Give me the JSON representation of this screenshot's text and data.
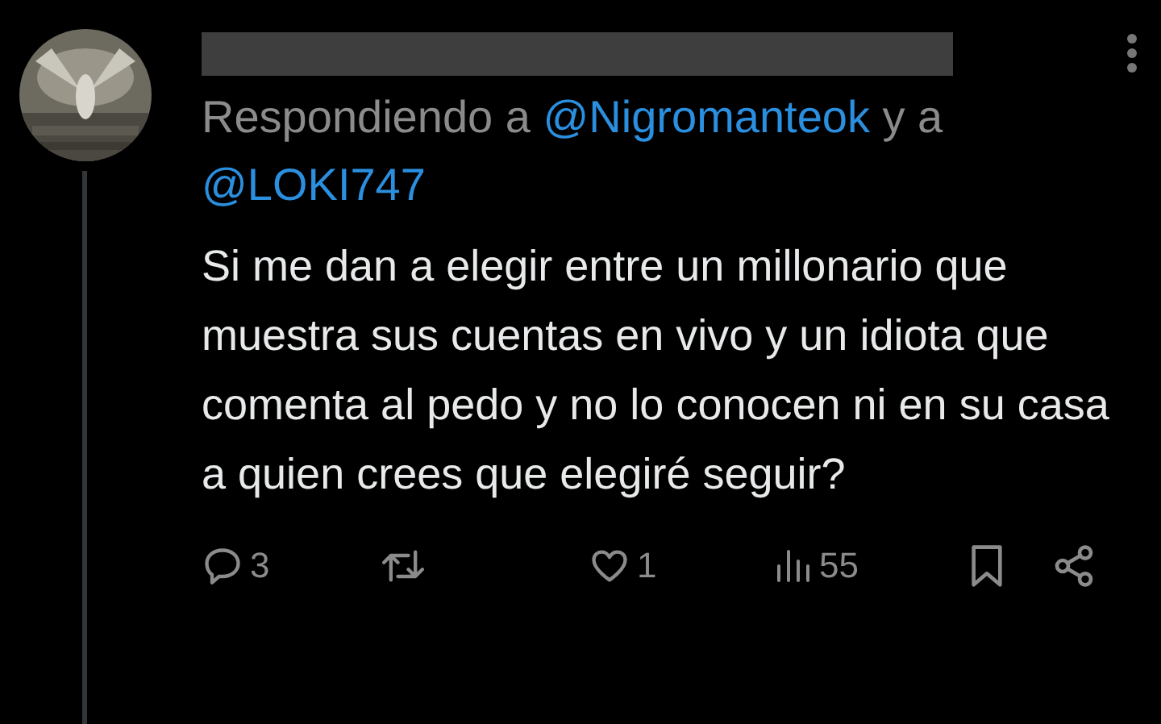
{
  "reply_to": {
    "prefix": "Respondiendo a",
    "mentions": [
      "@Nigromanteok",
      "@LOKI747"
    ],
    "joiner": "y a"
  },
  "body": "Si me dan a elegir entre un millonario que muestra sus cuentas en vivo y un idiota que comenta al pedo y no lo conocen ni en su casa a quien crees que elegiré seguir?",
  "actions": [
    {
      "kind": "reply",
      "count": "3"
    },
    {
      "kind": "repost"
    },
    {
      "kind": "like",
      "count": "1"
    },
    {
      "kind": "views",
      "count": "55"
    },
    {
      "kind": "bookmark"
    },
    {
      "kind": "share"
    }
  ]
}
